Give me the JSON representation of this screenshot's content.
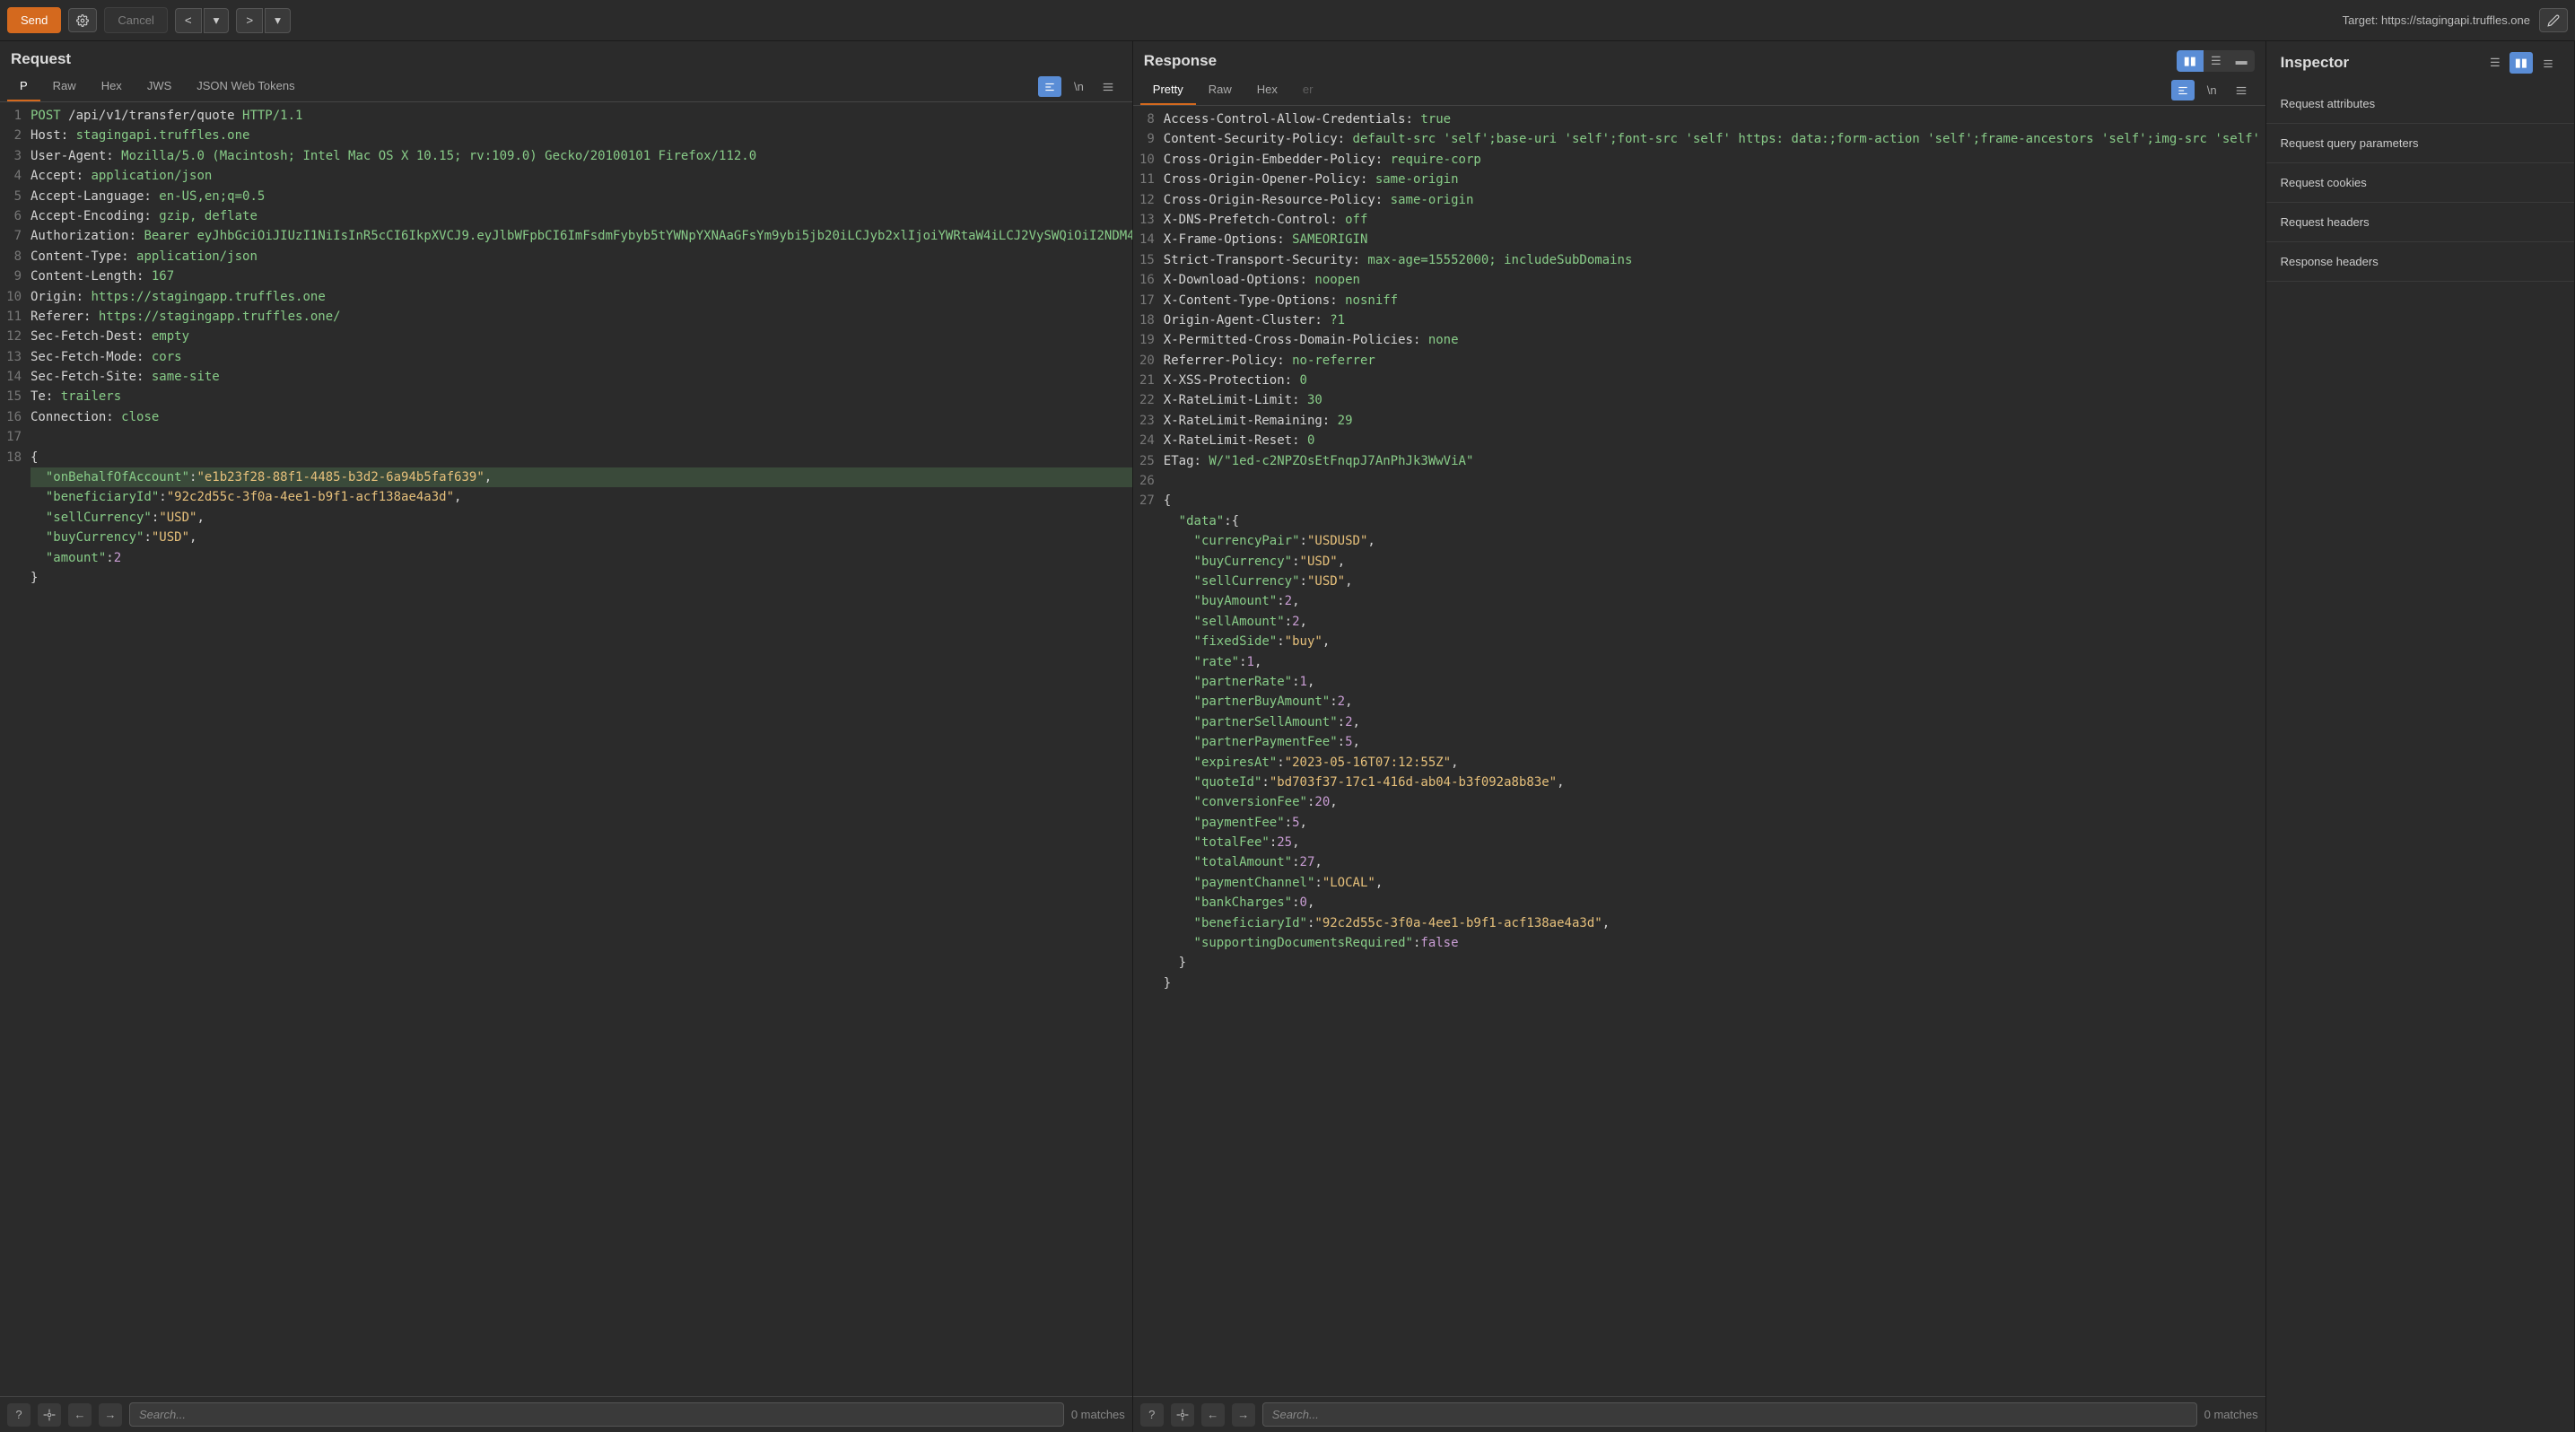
{
  "toolbar": {
    "send": "Send",
    "cancel": "Cancel",
    "target_prefix": "Target: ",
    "target": "https://stagingapi.truffles.one"
  },
  "request": {
    "title": "Request",
    "tabs": [
      "P",
      "Raw",
      "Hex",
      "JWS",
      "JSON Web Tokens"
    ],
    "active_tab": 0,
    "lines": [
      {
        "n": 1,
        "html": "<span class='kw'>POST</span> /api/v1/transfer/quote <span class='kw'>HTTP/1.1</span>"
      },
      {
        "n": 2,
        "html": "<span class='hdr'>Host:</span> <span class='val'>stagingapi.truffles.one</span>"
      },
      {
        "n": 3,
        "html": "<span class='hdr'>User-Agent:</span> <span class='val'>Mozilla/5.0 (Macintosh; Intel Mac OS X 10.15; rv:109.0) Gecko/20100101 Firefox/112.0</span>"
      },
      {
        "n": 4,
        "html": "<span class='hdr'>Accept:</span> <span class='val'>application/json</span>"
      },
      {
        "n": 5,
        "html": "<span class='hdr'>Accept-Language:</span> <span class='val'>en-US,en;q=0.5</span>"
      },
      {
        "n": 6,
        "html": "<span class='hdr'>Accept-Encoding:</span> <span class='val'>gzip, deflate</span>"
      },
      {
        "n": 7,
        "html": "<span class='hdr'>Authorization:</span> <span class='val'>Bearer eyJhbGciOiJIUzI1NiIsInR5cCI6IkpXVCJ9.eyJlbWFpbCI6ImFsdmFybyb5tYWNpYXNAaGFsYm9ybi5jb20iLCJyb2xlIjoiYWRtaW4iLCJ2VySWQiOiI2NDM4MDVjY2NhZTliY2NmNGMyZTgyZTAiLCJpYXQiOjE2ODYWMTk3MDgsImV4cCI6MTkwNjkwOH0.0ZgXAcjbCcNzYxjrffGk18fxx7zjCHaq-RuLiWa0n1M</span>"
      },
      {
        "n": 8,
        "html": "<span class='hdr'>Content-Type:</span> <span class='val'>application/json</span>"
      },
      {
        "n": 9,
        "html": "<span class='hdr'>Content-Length:</span> <span class='val'>167</span>"
      },
      {
        "n": 10,
        "html": "<span class='hdr'>Origin:</span> <span class='val'>https://stagingapp.truffles.one</span>"
      },
      {
        "n": 11,
        "html": "<span class='hdr'>Referer:</span> <span class='val'>https://stagingapp.truffles.one/</span>"
      },
      {
        "n": 12,
        "html": "<span class='hdr'>Sec-Fetch-Dest:</span> <span class='val'>empty</span>"
      },
      {
        "n": 13,
        "html": "<span class='hdr'>Sec-Fetch-Mode:</span> <span class='val'>cors</span>"
      },
      {
        "n": 14,
        "html": "<span class='hdr'>Sec-Fetch-Site:</span> <span class='val'>same-site</span>"
      },
      {
        "n": 15,
        "html": "<span class='hdr'>Te:</span> <span class='val'>trailers</span>"
      },
      {
        "n": 16,
        "html": "<span class='hdr'>Connection:</span> <span class='val'>close</span>"
      },
      {
        "n": 17,
        "html": ""
      },
      {
        "n": 18,
        "html": "<span class='punct'>{</span>"
      },
      {
        "n": "",
        "hl": true,
        "html": "  <span class='json-key'>\"onBehalfOfAccount\"</span><span class='punct'>:</span><span class='str'>\"e1b23f28-88f1-4485-b3d2-6a94b5faf639\"</span><span class='punct'>,</span>"
      },
      {
        "n": "",
        "html": "  <span class='json-key'>\"beneficiaryId\"</span><span class='punct'>:</span><span class='str'>\"92c2d55c-3f0a-4ee1-b9f1-acf138ae4a3d\"</span><span class='punct'>,</span>"
      },
      {
        "n": "",
        "html": "  <span class='json-key'>\"sellCurrency\"</span><span class='punct'>:</span><span class='str'>\"USD\"</span><span class='punct'>,</span>"
      },
      {
        "n": "",
        "html": "  <span class='json-key'>\"buyCurrency\"</span><span class='punct'>:</span><span class='str'>\"USD\"</span><span class='punct'>,</span>"
      },
      {
        "n": "",
        "html": "  <span class='json-key'>\"amount\"</span><span class='punct'>:</span><span class='num'>2</span>"
      },
      {
        "n": "",
        "html": "<span class='punct'>}</span>"
      }
    ],
    "search_placeholder": "Search...",
    "matches": "0 matches"
  },
  "response": {
    "title": "Response",
    "tabs": [
      "Pretty",
      "Raw",
      "Hex"
    ],
    "active_tab": 0,
    "lines": [
      {
        "n": 8,
        "html": "<span class='hdr'>Access-Control-Allow-Credentials:</span> <span class='val'>true</span>"
      },
      {
        "n": 9,
        "html": "<span class='hdr'>Content-Security-Policy:</span> <span class='val'>default-src 'self';base-uri 'self';font-src 'self' https: data:;form-action 'self';frame-ancestors 'self';img-src 'self' data:;object-src 'none';script-src 'self';script-src-attr 'none';style-src 'self' https: 'unsafe-inline';upgrade-insecure-requests</span>"
      },
      {
        "n": 10,
        "html": "<span class='hdr'>Cross-Origin-Embedder-Policy:</span> <span class='val'>require-corp</span>"
      },
      {
        "n": 11,
        "html": "<span class='hdr'>Cross-Origin-Opener-Policy:</span> <span class='val'>same-origin</span>"
      },
      {
        "n": 12,
        "html": "<span class='hdr'>Cross-Origin-Resource-Policy:</span> <span class='val'>same-origin</span>"
      },
      {
        "n": 13,
        "html": "<span class='hdr'>X-DNS-Prefetch-Control:</span> <span class='val'>off</span>"
      },
      {
        "n": 14,
        "html": "<span class='hdr'>X-Frame-Options:</span> <span class='val'>SAMEORIGIN</span>"
      },
      {
        "n": 15,
        "html": "<span class='hdr'>Strict-Transport-Security:</span> <span class='val'>max-age=15552000; includeSubDomains</span>"
      },
      {
        "n": 16,
        "html": "<span class='hdr'>X-Download-Options:</span> <span class='val'>noopen</span>"
      },
      {
        "n": 17,
        "html": "<span class='hdr'>X-Content-Type-Options:</span> <span class='val'>nosniff</span>"
      },
      {
        "n": 18,
        "html": "<span class='hdr'>Origin-Agent-Cluster:</span> <span class='val'>?1</span>"
      },
      {
        "n": 19,
        "html": "<span class='hdr'>X-Permitted-Cross-Domain-Policies:</span> <span class='val'>none</span>"
      },
      {
        "n": 20,
        "html": "<span class='hdr'>Referrer-Policy:</span> <span class='val'>no-referrer</span>"
      },
      {
        "n": 21,
        "html": "<span class='hdr'>X-XSS-Protection:</span> <span class='val'>0</span>"
      },
      {
        "n": 22,
        "html": "<span class='hdr'>X-RateLimit-Limit:</span> <span class='val'>30</span>"
      },
      {
        "n": 23,
        "html": "<span class='hdr'>X-RateLimit-Remaining:</span> <span class='val'>29</span>"
      },
      {
        "n": 24,
        "html": "<span class='hdr'>X-RateLimit-Reset:</span> <span class='val'>0</span>"
      },
      {
        "n": 25,
        "html": "<span class='hdr'>ETag:</span> <span class='val'>W/\"1ed-c2NPZOsEtFnqpJ7AnPhJk3WwViA\"</span>"
      },
      {
        "n": 26,
        "html": ""
      },
      {
        "n": 27,
        "html": "<span class='punct'>{</span>"
      },
      {
        "n": "",
        "html": "  <span class='json-key'>\"data\"</span><span class='punct'>:{</span>"
      },
      {
        "n": "",
        "html": "    <span class='json-key'>\"currencyPair\"</span><span class='punct'>:</span><span class='str'>\"USDUSD\"</span><span class='punct'>,</span>"
      },
      {
        "n": "",
        "html": "    <span class='json-key'>\"buyCurrency\"</span><span class='punct'>:</span><span class='str'>\"USD\"</span><span class='punct'>,</span>"
      },
      {
        "n": "",
        "html": "    <span class='json-key'>\"sellCurrency\"</span><span class='punct'>:</span><span class='str'>\"USD\"</span><span class='punct'>,</span>"
      },
      {
        "n": "",
        "html": "    <span class='json-key'>\"buyAmount\"</span><span class='punct'>:</span><span class='num'>2</span><span class='punct'>,</span>"
      },
      {
        "n": "",
        "html": "    <span class='json-key'>\"sellAmount\"</span><span class='punct'>:</span><span class='num'>2</span><span class='punct'>,</span>"
      },
      {
        "n": "",
        "html": "    <span class='json-key'>\"fixedSide\"</span><span class='punct'>:</span><span class='str'>\"buy\"</span><span class='punct'>,</span>"
      },
      {
        "n": "",
        "html": "    <span class='json-key'>\"rate\"</span><span class='punct'>:</span><span class='num'>1</span><span class='punct'>,</span>"
      },
      {
        "n": "",
        "html": "    <span class='json-key'>\"partnerRate\"</span><span class='punct'>:</span><span class='num'>1</span><span class='punct'>,</span>"
      },
      {
        "n": "",
        "html": "    <span class='json-key'>\"partnerBuyAmount\"</span><span class='punct'>:</span><span class='num'>2</span><span class='punct'>,</span>"
      },
      {
        "n": "",
        "html": "    <span class='json-key'>\"partnerSellAmount\"</span><span class='punct'>:</span><span class='num'>2</span><span class='punct'>,</span>"
      },
      {
        "n": "",
        "html": "    <span class='json-key'>\"partnerPaymentFee\"</span><span class='punct'>:</span><span class='num'>5</span><span class='punct'>,</span>"
      },
      {
        "n": "",
        "html": "    <span class='json-key'>\"expiresAt\"</span><span class='punct'>:</span><span class='str'>\"2023-05-16T07:12:55Z\"</span><span class='punct'>,</span>"
      },
      {
        "n": "",
        "html": "    <span class='json-key'>\"quoteId\"</span><span class='punct'>:</span><span class='str'>\"bd703f37-17c1-416d-ab04-b3f092a8b83e\"</span><span class='punct'>,</span>"
      },
      {
        "n": "",
        "html": "    <span class='json-key'>\"conversionFee\"</span><span class='punct'>:</span><span class='num'>20</span><span class='punct'>,</span>"
      },
      {
        "n": "",
        "html": "    <span class='json-key'>\"paymentFee\"</span><span class='punct'>:</span><span class='num'>5</span><span class='punct'>,</span>"
      },
      {
        "n": "",
        "html": "    <span class='json-key'>\"totalFee\"</span><span class='punct'>:</span><span class='num'>25</span><span class='punct'>,</span>"
      },
      {
        "n": "",
        "html": "    <span class='json-key'>\"totalAmount\"</span><span class='punct'>:</span><span class='num'>27</span><span class='punct'>,</span>"
      },
      {
        "n": "",
        "html": "    <span class='json-key'>\"paymentChannel\"</span><span class='punct'>:</span><span class='str'>\"LOCAL\"</span><span class='punct'>,</span>"
      },
      {
        "n": "",
        "html": "    <span class='json-key'>\"bankCharges\"</span><span class='punct'>:</span><span class='num'>0</span><span class='punct'>,</span>"
      },
      {
        "n": "",
        "html": "    <span class='json-key'>\"beneficiaryId\"</span><span class='punct'>:</span><span class='str'>\"92c2d55c-3f0a-4ee1-b9f1-acf138ae4a3d\"</span><span class='punct'>,</span>"
      },
      {
        "n": "",
        "html": "    <span class='json-key'>\"supportingDocumentsRequired\"</span><span class='punct'>:</span><span class='bool'>false</span>"
      },
      {
        "n": "",
        "html": "  <span class='punct'>}</span>"
      },
      {
        "n": "",
        "html": "<span class='punct'>}</span>"
      }
    ],
    "search_placeholder": "Search...",
    "matches": "0 matches"
  },
  "inspector": {
    "title": "Inspector",
    "items": [
      "Request attributes",
      "Request query parameters",
      "Request cookies",
      "Request headers",
      "Response headers"
    ]
  }
}
